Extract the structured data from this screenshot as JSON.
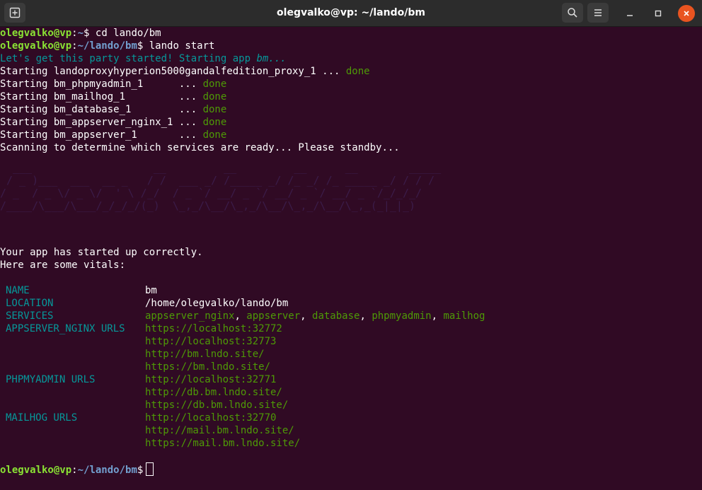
{
  "window": {
    "title": "olegvalko@vp: ~/lando/bm"
  },
  "colors": {
    "background": "#300a24",
    "user_host": "#8ae234",
    "path": "#729fcf",
    "done": "#4e9a06",
    "key": "#06989a",
    "close_button": "#e95420"
  },
  "prompt": {
    "user_host": "olegvalko@vp",
    "sep": ":",
    "sym": "$"
  },
  "commands": [
    {
      "path": "~",
      "cmd": " cd lando/bm"
    },
    {
      "path": "~/lando/bm",
      "cmd": " lando start"
    }
  ],
  "intro": {
    "pre": "Let's get this party started! Starting app ",
    "app": "bm",
    "post": "..."
  },
  "starting": [
    {
      "text": "Starting landoproxyhyperion5000gandalfedition_proxy_1 ... ",
      "status": "done"
    },
    {
      "text": "Starting bm_phpmyadmin_1      ... ",
      "status": "done"
    },
    {
      "text": "Starting bm_mailhog_1         ... ",
      "status": "done"
    },
    {
      "text": "Starting bm_database_1        ... ",
      "status": "done"
    },
    {
      "text": "Starting bm_appserver_nginx_1 ... ",
      "status": "done"
    },
    {
      "text": "Starting bm_appserver_1       ... ",
      "status": "done"
    }
  ],
  "scanning": "Scanning to determine which services are ready... Please standby...",
  "started_msg": "Your app has started up correctly.",
  "vitals_header": "Here are some vitals:",
  "vitals": {
    "name_key": "NAME",
    "name": "bm",
    "location_key": "LOCATION",
    "location": "/home/olegvalko/lando/bm",
    "services_key": "SERVICES",
    "services": [
      "appserver_nginx",
      "appserver",
      "database",
      "phpmyadmin",
      "mailhog"
    ],
    "services_sep": ", ",
    "nginx_key": "APPSERVER_NGINX URLS",
    "nginx_urls": [
      "https://localhost:32772",
      "http://localhost:32773",
      "http://bm.lndo.site/",
      "https://bm.lndo.site/"
    ],
    "pma_key": "PHPMYADMIN URLS",
    "pma_urls": [
      "http://localhost:32771",
      "http://db.bm.lndo.site/",
      "https://db.bm.lndo.site/"
    ],
    "mailhog_key": "MAILHOG URLS",
    "mailhog_urls": [
      "http://localhost:32770",
      "http://mail.bm.lndo.site/",
      "https://mail.bm.lndo.site/"
    ]
  },
  "final_prompt_path": "~/lando/bm",
  "icons": {
    "new_tab": "new-tab-icon",
    "search": "search-icon",
    "menu": "hamburger-menu-icon",
    "minimize": "minimize-icon",
    "maximize": "maximize-icon",
    "close": "close-icon"
  }
}
